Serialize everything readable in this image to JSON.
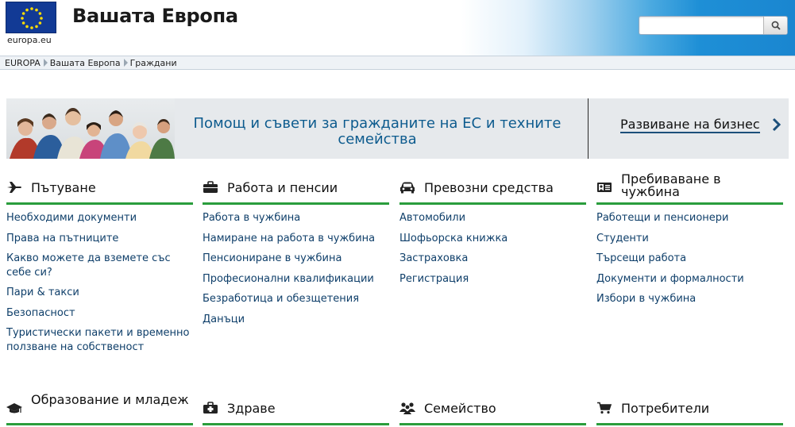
{
  "header": {
    "logo_text": "europa.eu",
    "site_title": "Вашата Европа",
    "search_placeholder": "",
    "search_icon": "search-icon"
  },
  "breadcrumb": [
    "EUROPA",
    "Вашата Европа",
    "Граждани"
  ],
  "banner": {
    "help_text": "Помощ и съвети за гражданите на ЕС и техните семейства",
    "business_link": "Развиване на бизнес"
  },
  "sections": [
    {
      "title": "Пътуване",
      "icon": "airplane-icon",
      "links": [
        "Необходими документи",
        "Права на пътниците",
        "Какво можете да вземете със себе си?",
        "Пари & такси",
        "Безопасност",
        "Туристически пакети и временно ползване на собственост"
      ]
    },
    {
      "title": "Работа и пенсии",
      "icon": "briefcase-icon",
      "links": [
        "Работа в чужбина",
        "Намиране на работа в чужбина",
        "Пенсиониране в чужбина",
        "Професионални квалификации",
        "Безработица и обезщетения",
        "Данъци"
      ]
    },
    {
      "title": "Превозни средства",
      "icon": "car-icon",
      "links": [
        "Автомобили",
        "Шофьорска книжка",
        "Застраховка",
        "Регистрация"
      ]
    },
    {
      "title": "Пребиваване в чужбина",
      "icon": "id-card-icon",
      "links": [
        "Работещи и пенсионери",
        "Студенти",
        "Търсещи работа",
        "Документи и формалности",
        "Избори в чужбина"
      ]
    },
    {
      "title": "Образование и младеж",
      "icon": "graduation-cap-icon",
      "links": []
    },
    {
      "title": "Здраве",
      "icon": "medical-kit-icon",
      "links": []
    },
    {
      "title": "Семейство",
      "icon": "family-icon",
      "links": []
    },
    {
      "title": "Потребители",
      "icon": "shopping-cart-icon",
      "links": []
    }
  ],
  "colors": {
    "accent_green": "#2a9d3c",
    "link_blue": "#0f3f6a",
    "banner_text": "#0d5b8e",
    "eu_blue": "#123a95",
    "eu_star": "#ffdd00"
  }
}
